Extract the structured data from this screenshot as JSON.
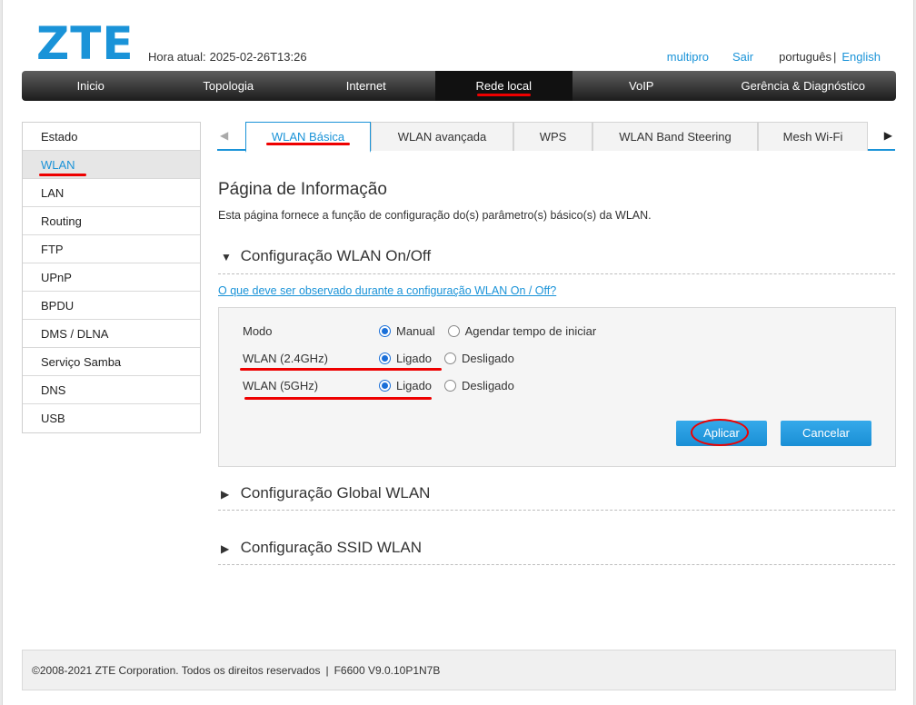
{
  "header": {
    "logo": "ZTE",
    "clock_label": "Hora atual:",
    "clock_value": "2025-02-26T13:26",
    "user": "multipro",
    "logout": "Sair",
    "lang_current": "português",
    "lang_sep": "|",
    "lang_other": "English"
  },
  "nav": {
    "items": [
      "Inicio",
      "Topologia",
      "Internet",
      "Rede local",
      "VoIP",
      "Gerência & Diagnóstico"
    ],
    "active": "Rede local"
  },
  "sidebar": {
    "items": [
      "Estado",
      "WLAN",
      "LAN",
      "Routing",
      "FTP",
      "UPnP",
      "BPDU",
      "DMS / DLNA",
      "Serviço Samba",
      "DNS",
      "USB"
    ],
    "active": "WLAN"
  },
  "tabs": {
    "items": [
      "WLAN Básica",
      "WLAN avançada",
      "WPS",
      "WLAN Band Steering",
      "Mesh Wi-Fi"
    ],
    "active": "WLAN Básica",
    "prev_arrow": "◀",
    "next_arrow": "▶"
  },
  "content": {
    "title": "Página de Informação",
    "description": "Esta página fornece a função de configuração do(s) parâmetro(s) básico(s) da WLAN.",
    "section1": {
      "title": "Configuração WLAN On/Off",
      "expanded_icon": "▼",
      "help_link": "O que deve ser observado durante a configuração WLAN On / Off?",
      "rows": {
        "mode": {
          "label": "Modo",
          "opt1": "Manual",
          "opt2": "Agendar tempo de iniciar",
          "selected": "Manual"
        },
        "wlan24": {
          "label": "WLAN (2.4GHz)",
          "opt1": "Ligado",
          "opt2": "Desligado",
          "selected": "Ligado"
        },
        "wlan5": {
          "label": "WLAN (5GHz)",
          "opt1": "Ligado",
          "opt2": "Desligado",
          "selected": "Ligado"
        }
      },
      "apply": "Aplicar",
      "cancel": "Cancelar"
    },
    "section2": {
      "title": "Configuração Global WLAN",
      "collapsed_icon": "▶"
    },
    "section3": {
      "title": "Configuração SSID WLAN",
      "collapsed_icon": "▶"
    }
  },
  "footer": {
    "copyright": "©2008-2021 ZTE Corporation. Todos os direitos reservados",
    "sep": "|",
    "version": "F6600 V9.0.10P1N7B"
  },
  "colors": {
    "accent": "#1a93d8",
    "annotation": "#e00000",
    "nav_bg": "#2a2a2a"
  }
}
